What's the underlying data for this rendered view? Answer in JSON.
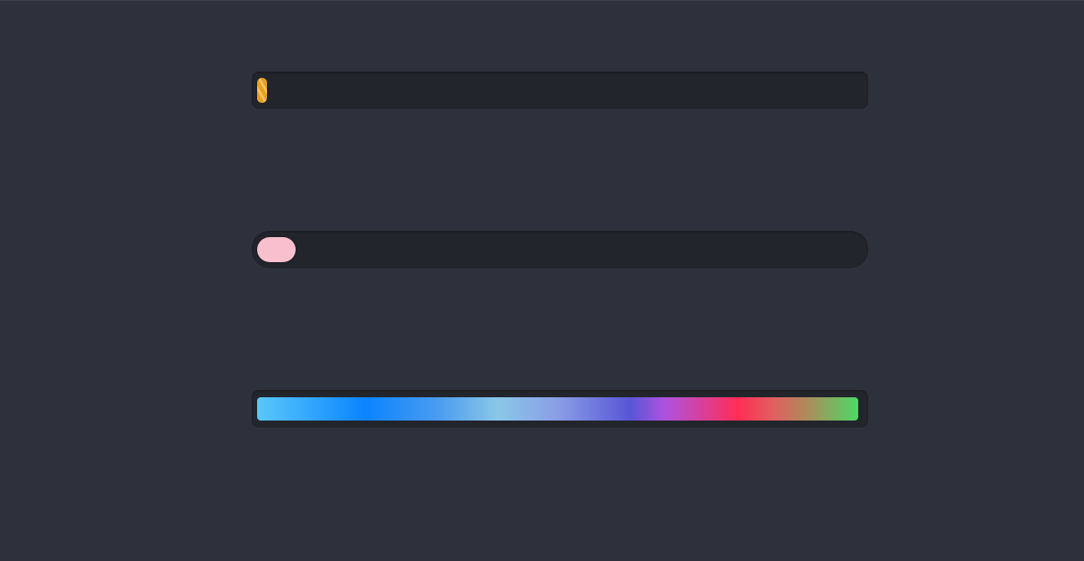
{
  "colors": {
    "background": "#2d313b",
    "track": "#23252c",
    "orange": "#f5a623",
    "pink": "#f7c0cc",
    "rainbow": [
      "#5ac8fa",
      "#0a84ff",
      "#8ac7e8",
      "#5856d6",
      "#ff2d55",
      "#4cd964"
    ]
  },
  "progress_bars": [
    {
      "style": "striped-orange",
      "progress_percent": 1
    },
    {
      "style": "pink-pill",
      "progress_percent": 6
    },
    {
      "style": "rainbow-gradient",
      "progress_percent": 100
    }
  ]
}
